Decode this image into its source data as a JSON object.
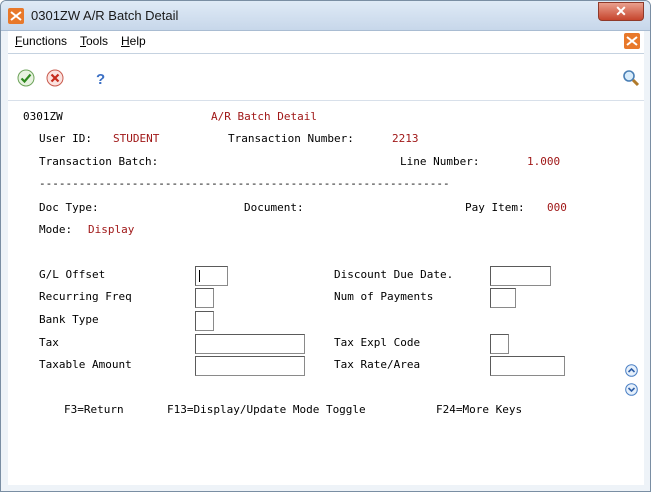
{
  "window": {
    "title": "0301ZW   A/R Batch Detail"
  },
  "menu": {
    "items": [
      "Functions",
      "Tools",
      "Help"
    ]
  },
  "screen": {
    "program_id": "0301ZW",
    "title": "A/R Batch Detail",
    "user_id_label": "User ID:",
    "user_id": "STUDENT",
    "txn_number_label": "Transaction Number:",
    "txn_number": "2213",
    "txn_batch_label": "Transaction Batch:",
    "line_number_label": "Line Number:",
    "line_number": "1.000",
    "separator": "--------------------------------------------------------------",
    "doc_type_label": "Doc Type:",
    "document_label": "Document:",
    "pay_item_label": "Pay Item:",
    "pay_item": "000",
    "mode_label": "Mode:",
    "mode": "Display",
    "gl_offset_label": "G/L Offset",
    "recurring_freq_label": "Recurring Freq",
    "bank_type_label": "Bank Type",
    "tax_label": "Tax",
    "taxable_amount_label": "Taxable Amount",
    "discount_due_label": "Discount Due Date.",
    "num_payments_label": "Num of Payments",
    "tax_expl_label": "Tax Expl Code",
    "tax_rate_label": "Tax Rate/Area",
    "fkey_return": "F3=Return",
    "fkey_toggle": "F13=Display/Update Mode Toggle",
    "fkey_more": "F24=More Keys"
  },
  "colors": {
    "value_red": "#a01818",
    "close_red": "#c6452d"
  }
}
